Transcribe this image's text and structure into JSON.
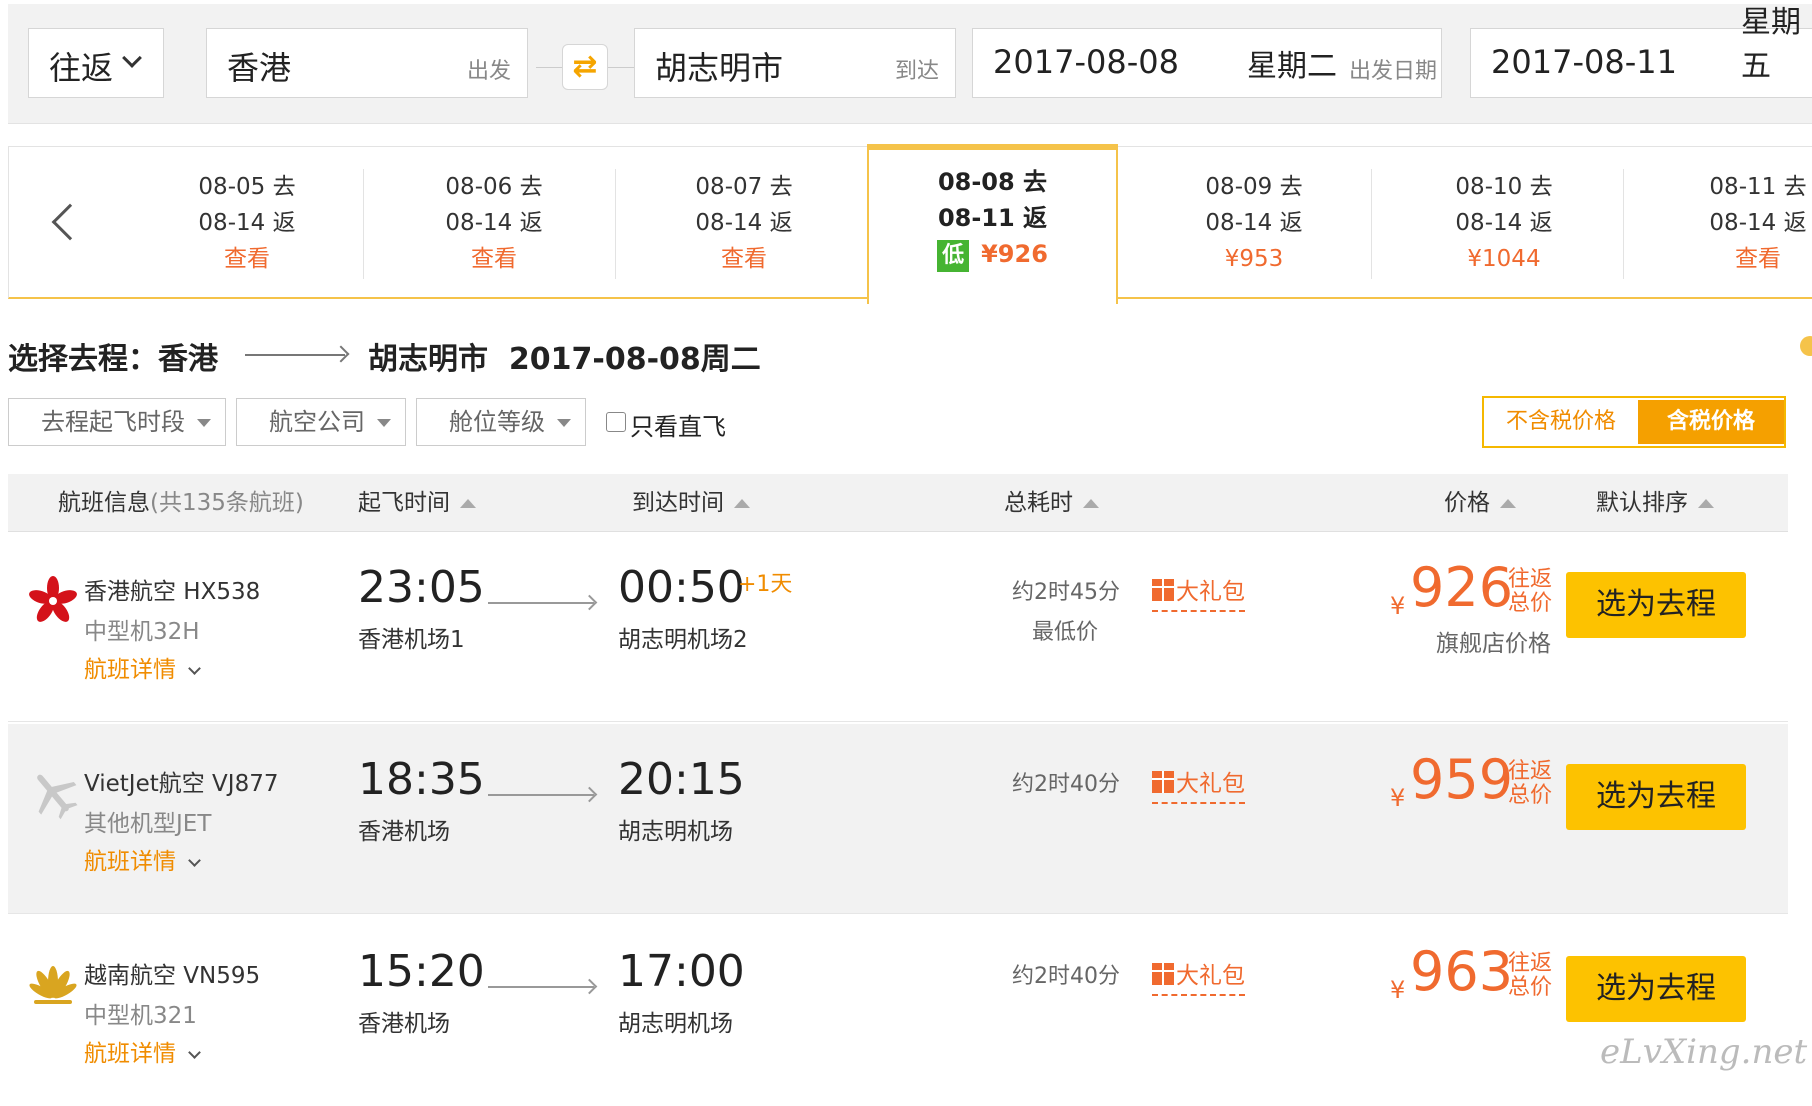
{
  "search": {
    "trip_type": "往返",
    "from_city": "香港",
    "from_label": "出发",
    "to_city": "胡志明市",
    "to_label": "到达",
    "depart_date": "2017-08-08",
    "depart_weekday": "星期二",
    "depart_label": "出发日期",
    "return_date": "2017-08-11",
    "return_weekday": "星期五"
  },
  "date_strip": {
    "cells": [
      {
        "go": "08-05 去",
        "back": "08-14 返",
        "value": "查看"
      },
      {
        "go": "08-06 去",
        "back": "08-14 返",
        "value": "查看"
      },
      {
        "go": "08-07 去",
        "back": "08-14 返",
        "value": "查看"
      },
      {
        "go": "08-08 去",
        "back": "08-11 返",
        "value": "¥926",
        "badge": "低",
        "selected": true
      },
      {
        "go": "08-09 去",
        "back": "08-14 返",
        "value": "¥953"
      },
      {
        "go": "08-10 去",
        "back": "08-14 返",
        "value": "¥1044"
      },
      {
        "go": "08-11 去",
        "back": "08-14 返",
        "value": "查看"
      }
    ]
  },
  "route_title": {
    "prefix": "选择去程：",
    "from": "香港",
    "to": "胡志明市",
    "date": "2017-08-08周二"
  },
  "filters": {
    "time": "去程起飞时段",
    "airline": "航空公司",
    "cabin": "舱位等级",
    "direct_only": "只看直飞",
    "tax_excluded": "不含税价格",
    "tax_included": "含税价格"
  },
  "table_header": {
    "info": "航班信息",
    "count": "(共135条航班)",
    "depart": "起飞时间",
    "arrive": "到达时间",
    "duration": "总耗时",
    "price": "价格",
    "sort": "默认排序"
  },
  "flights": [
    {
      "airline": "香港航空 HX538",
      "plane": "中型机32H",
      "detail": "航班详情",
      "depart_time": "23:05",
      "depart_airport": "香港机场1",
      "arrive_time": "00:50",
      "day_plus": "+1天",
      "arrive_airport": "胡志明机场2",
      "duration": "约2时45分",
      "lowest": "最低价",
      "gift": "大礼包",
      "currency": "¥",
      "price": "926",
      "price_tag": "往返总价",
      "flagship": "旗舰店价格",
      "button": "选为去程"
    },
    {
      "airline": "VietJet航空 VJ877",
      "plane": "其他机型JET",
      "detail": "航班详情",
      "depart_time": "18:35",
      "depart_airport": "香港机场",
      "arrive_time": "20:15",
      "arrive_airport": "胡志明机场",
      "duration": "约2时40分",
      "gift": "大礼包",
      "currency": "¥",
      "price": "959",
      "price_tag": "往返总价",
      "button": "选为去程"
    },
    {
      "airline": "越南航空 VN595",
      "plane": "中型机321",
      "detail": "航班详情",
      "depart_time": "15:20",
      "depart_airport": "香港机场",
      "arrive_time": "17:00",
      "arrive_airport": "胡志明机场",
      "duration": "约2时40分",
      "gift": "大礼包",
      "currency": "¥",
      "price": "963",
      "price_tag": "往返总价",
      "button": "选为去程"
    }
  ],
  "watermark": "eLvXing.net",
  "colors": {
    "accent": "#f5a000",
    "price": "#f06a2f",
    "button": "#fdc200",
    "low_badge": "#46b432"
  }
}
